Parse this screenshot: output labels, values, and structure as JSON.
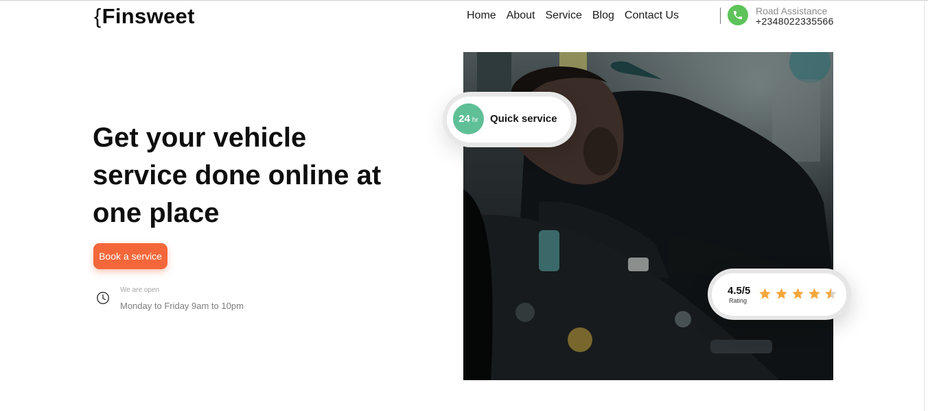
{
  "header": {
    "logo_brace": "{",
    "logo_text": "Finsweet",
    "nav": [
      "Home",
      "About",
      "Service",
      "Blog",
      "Contact Us"
    ],
    "road_assistance_label": "Road Assistance",
    "road_assistance_phone": "+2348022335566",
    "phone_icon": "phone-icon"
  },
  "hero": {
    "title_lines": [
      "Get your vehicle",
      "service done online at",
      "one place"
    ],
    "cta_label": "Book a service",
    "open_label": "We are open",
    "open_hours": "Monday to Friday 9am to 10pm",
    "clock_icon": "clock-icon"
  },
  "quick_service": {
    "number": "24",
    "unit": "hr",
    "label": "Quick service"
  },
  "rating": {
    "value": "4.5/5",
    "label": "Rating",
    "stars": 4.5,
    "star_color": "#f4a73b"
  },
  "colors": {
    "accent": "#f4673a",
    "phone_badge": "#5dc35a",
    "quick_badge": "#5fbf97"
  }
}
